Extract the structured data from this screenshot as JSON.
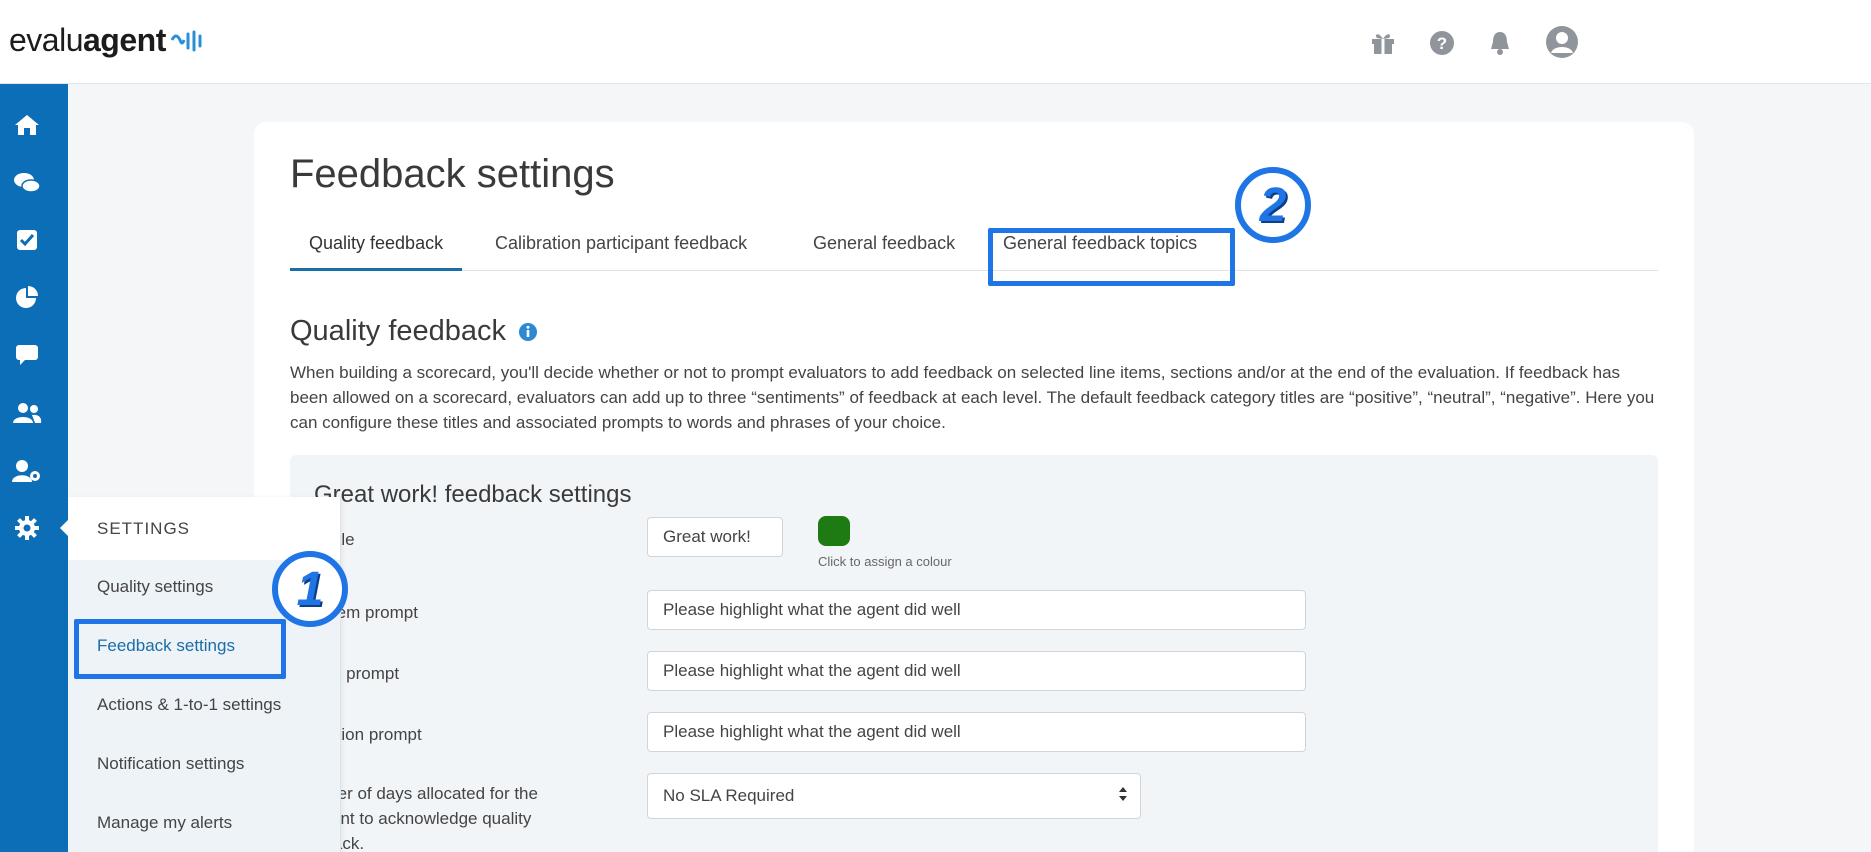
{
  "header": {
    "logo_text_light": "evalu",
    "logo_text_bold": "agent",
    "icons": [
      "gift-icon",
      "help-icon",
      "bell-icon",
      "user-icon"
    ]
  },
  "sidebar": {
    "icons": [
      "home-icon",
      "chat-icon",
      "checkbox-icon",
      "pie-chart-icon",
      "comment-icon",
      "users-icon",
      "user-settings-icon",
      "gear-icon"
    ]
  },
  "settings_menu": {
    "title": "SETTINGS",
    "items": [
      {
        "label": "Quality settings"
      },
      {
        "label": "Feedback settings"
      },
      {
        "label": "Actions & 1-to-1 settings"
      },
      {
        "label": "Notification settings"
      },
      {
        "label": "Manage my alerts"
      }
    ]
  },
  "page": {
    "title": "Feedback settings",
    "tabs": [
      {
        "label": "Quality feedback"
      },
      {
        "label": "Calibration participant feedback"
      },
      {
        "label": "General feedback"
      },
      {
        "label": "General feedback topics"
      }
    ],
    "section_title": "Quality feedback",
    "description": "When building a scorecard, you'll decide whether or not to prompt evaluators to add feedback on selected line items, sections and/or at the end of the evaluation. If feedback has been allowed on a scorecard, evaluators can add up to three “sentiments” of feedback at each level. The default feedback category titles are “positive”, “neutral”, “negative”. Here you can configure these titles and associated prompts to words and phrases of your choice."
  },
  "great_work_panel": {
    "title": "Great work! feedback settings",
    "tab_title_label": "b title",
    "tab_title_value": "Great work!",
    "colour_hint": "Click to assign a colour",
    "colour": "#1e7a12",
    "line_item_label": "e item prompt",
    "line_item_value": "Please highlight what the agent did well",
    "section_label": "tion prompt",
    "section_value": "Please highlight what the agent did well",
    "evaluation_label": "luation prompt",
    "evaluation_value": "Please highlight what the agent did well",
    "sla_label_line1": "mber of days allocated for the",
    "sla_label_line2": "ipient to acknowledge quality",
    "sla_label_line3": "dback.",
    "sla_value": "No SLA Required"
  },
  "annotations": {
    "badge_1": "1",
    "badge_2": "2",
    "highlight_color": "#1f74e6"
  },
  "colors": {
    "sidebar": "#0d6eb8",
    "accent": "#1a6da8"
  }
}
